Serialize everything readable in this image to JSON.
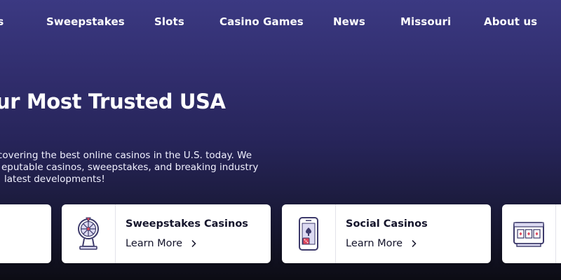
{
  "nav": {
    "items": [
      {
        "label": "os"
      },
      {
        "label": "Sweepstakes"
      },
      {
        "label": "Slots"
      },
      {
        "label": "Casino Games"
      },
      {
        "label": "News"
      },
      {
        "label": "Missouri"
      },
      {
        "label": "About us"
      }
    ]
  },
  "hero": {
    "title": "ur Most Trusted USA",
    "description_lines": [
      "covering the best online casinos in the U.S. today.  We",
      "eputable casinos, sweepstakes, and breaking industry",
      "latest developments!"
    ]
  },
  "cards": [
    {
      "title": "",
      "link": "",
      "icon": "partial-card"
    },
    {
      "title": "Sweepstakes Casinos",
      "link": "Learn More",
      "icon": "prize-wheel-icon"
    },
    {
      "title": "Social Casinos",
      "link": "Learn More",
      "icon": "phone-cards-icon"
    },
    {
      "title": "",
      "link": "",
      "icon": "slot-machine-icon"
    }
  ],
  "colors": {
    "bg_top": "#3b3982",
    "bg_bottom": "#0c0c14",
    "card_bg": "#ffffff",
    "card_text": "#14142b",
    "icon_stroke": "#3d3a6b",
    "icon_accent": "#e0475c",
    "icon_fill": "#dcdaf2"
  }
}
